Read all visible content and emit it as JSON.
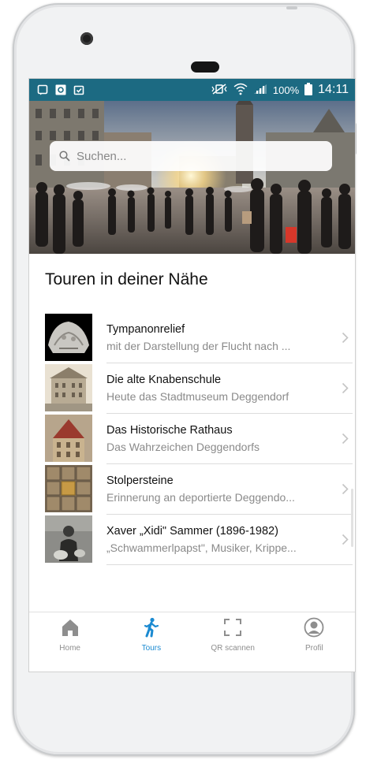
{
  "status_bar": {
    "battery_percent": "100%",
    "time": "14:11"
  },
  "search": {
    "placeholder": "Suchen..."
  },
  "section": {
    "title": "Touren in deiner Nähe"
  },
  "tours": [
    {
      "title": "Tympanonrelief",
      "subtitle": "mit der Darstellung der Flucht nach ..."
    },
    {
      "title": "Die alte Knabenschule",
      "subtitle": "Heute das Stadtmuseum Deggendorf"
    },
    {
      "title": "Das Historische Rathaus",
      "subtitle": "Das Wahrzeichen Deggendorfs"
    },
    {
      "title": "Stolpersteine",
      "subtitle": "Erinnerung an deportierte Deggendo..."
    },
    {
      "title": "Xaver „Xidi\" Sammer (1896-1982)",
      "subtitle": "„Schwammerlpapst\", Musiker, Krippe..."
    }
  ],
  "tabbar": {
    "items": [
      {
        "label": "Home",
        "icon": "home-icon"
      },
      {
        "label": "Tours",
        "icon": "walking-person-icon",
        "active": true
      },
      {
        "label": "QR scannen",
        "icon": "qr-scan-icon"
      },
      {
        "label": "Profil",
        "icon": "profile-icon"
      }
    ]
  },
  "colors": {
    "status_bar": "#1c6a82",
    "tab_active": "#1b8ad1",
    "tab_inactive": "#8e8e8e"
  }
}
